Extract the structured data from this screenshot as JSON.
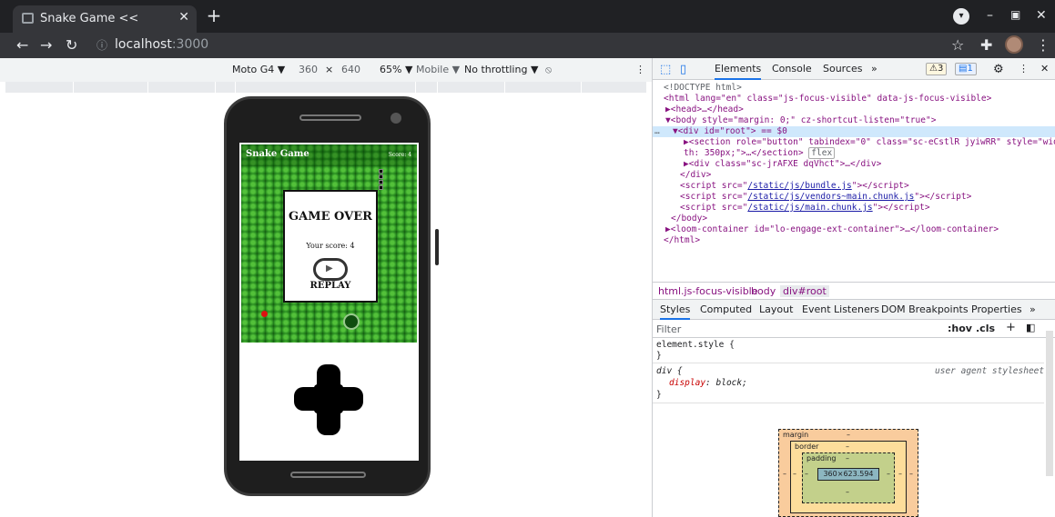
{
  "browser": {
    "tab_title": "Snake Game <<",
    "tab_close": "✕",
    "new_tab": "+",
    "url_host": "localhost",
    "url_port": ":3000",
    "window_controls": {
      "minimize": "–",
      "restore": "▣",
      "close": "✕"
    }
  },
  "device_toolbar": {
    "device": "Moto G4 ▼",
    "width": "360",
    "times": "×",
    "height": "640",
    "zoom": "65% ▼",
    "mode": "Mobile ▼",
    "throttle": "No throttling ▼",
    "more": "⋮"
  },
  "game": {
    "title": "Snake Game",
    "score": "Score: 4",
    "over_title": "GAME OVER",
    "over_score": "Your score: 4",
    "play_glyph": "▶",
    "replay": "REPLAY"
  },
  "devtools": {
    "tabs": [
      "Elements",
      "Console",
      "Sources",
      "»"
    ],
    "warnings": "⚠3",
    "messages": "1",
    "dom": {
      "doctype": "<!DOCTYPE html>",
      "html_open": "<html lang=\"en\" class=\"js-focus-visible\" data-js-focus-visible>",
      "head": "▶<head>…</head>",
      "body_open": "▼<body style=\"margin: 0;\" cz-shortcut-listen=\"true\">",
      "div_root": "▼<div id=\"root\"> == $0",
      "dots": "…",
      "section_1": "▶<section role=\"button\" tabindex=\"0\" class=\"sc-eCstlR jyiwRR\" style=\"wid",
      "section_2": "th: 350px;\">…</section>",
      "flex": "flex",
      "div_child": "▶<div class=\"sc-jrAFXE dqVhct\">…</div>",
      "div_close": "</div>",
      "script_1": "/static/js/bundle.js",
      "script_2": "/static/js/vendors~main.chunk.js",
      "script_3": "/static/js/main.chunk.js",
      "body_close": "</body>",
      "loom": "▶<loom-container id=\"lo-engage-ext-container\">…</loom-container>",
      "html_close": "</html>"
    },
    "breadcrumbs": [
      "html.js-focus-visible",
      "body",
      "div#root"
    ],
    "style_tabs": [
      "Styles",
      "Computed",
      "Layout",
      "Event Listeners",
      "DOM Breakpoints",
      "Properties",
      "»"
    ],
    "filter_placeholder": "Filter",
    "filter_tools": [
      ":hov",
      ".cls",
      "+"
    ],
    "styles": {
      "element_style": "element.style {",
      "close": "}",
      "div_rule": "div {",
      "ua": "user agent stylesheet",
      "prop": "display",
      "value": "block;"
    },
    "box_model": {
      "margin": "margin",
      "border": "border",
      "padding": "padding",
      "dash": "–",
      "content": "360×623.594"
    }
  }
}
